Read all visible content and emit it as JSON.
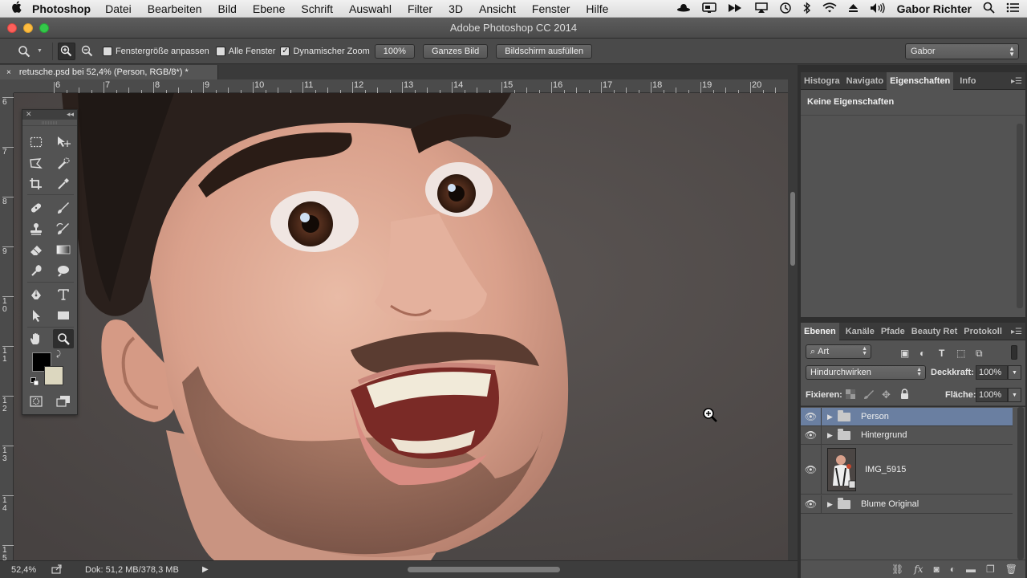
{
  "menubar": {
    "apple": "",
    "app": "Photoshop",
    "items": [
      "Datei",
      "Bearbeiten",
      "Bild",
      "Ebene",
      "Schrift",
      "Auswahl",
      "Filter",
      "3D",
      "Ansicht",
      "Fenster",
      "Hilfe"
    ],
    "user": "Gabor Richter"
  },
  "window": {
    "title": "Adobe Photoshop CC 2014"
  },
  "options": {
    "resize_label": "Fenstergröße anpassen",
    "all_windows_label": "Alle Fenster",
    "dynamic_zoom_label": "Dynamischer Zoom",
    "zoom_button": "100%",
    "fit_button": "Ganzes Bild",
    "fill_button": "Bildschirm ausfüllen",
    "workspace": "Gabor"
  },
  "document": {
    "tab": "retusche.psd bei 52,4% (Person, RGB/8*) *",
    "tab_close": "×"
  },
  "ruler": {
    "h_labels": [
      "6",
      "7",
      "8",
      "9",
      "10",
      "11",
      "12",
      "13",
      "14",
      "15",
      "16",
      "17",
      "18",
      "19",
      "20"
    ],
    "v_labels": [
      "6",
      "7",
      "8",
      "9",
      "1\n0",
      "1\n1",
      "1\n2",
      "1\n3",
      "1\n4",
      "1\n5"
    ]
  },
  "status": {
    "zoom": "52,4%",
    "doc": "Dok: 51,2 MB/378,3 MB"
  },
  "panels": {
    "top_tabs": [
      "Histogra",
      "Navigato",
      "Eigenschaften",
      "Info"
    ],
    "top_active": 2,
    "properties_text": "Keine Eigenschaften",
    "layer_tabs": [
      "Ebenen",
      "Kanäle",
      "Pfade",
      "Beauty Ret",
      "Protokoll"
    ],
    "layer_active": 0,
    "filter_kind": "Art",
    "blend_mode": "Hindurchwirken",
    "opacity_label": "Deckkraft:",
    "opacity_value": "100%",
    "lock_label": "Fixieren:",
    "fill_label": "Fläche:",
    "fill_value": "100%",
    "layers": [
      {
        "name": "Person",
        "type": "group",
        "selected": true
      },
      {
        "name": "Hintergrund",
        "type": "group",
        "selected": false
      },
      {
        "name": "IMG_5915",
        "type": "smart",
        "selected": false
      },
      {
        "name": "Blume Original",
        "type": "group",
        "selected": false
      }
    ]
  },
  "colors": {
    "selected_layer": "#6a7fa1",
    "panel": "#535353",
    "canvas_bg": "#534d4b"
  }
}
